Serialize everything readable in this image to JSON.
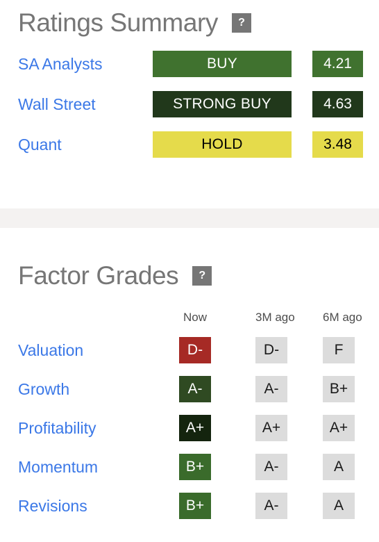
{
  "ratings_summary": {
    "title": "Ratings Summary",
    "help_icon": "question-mark-icon",
    "help_label": "?",
    "rows": [
      {
        "label": "SA Analysts",
        "rating": "BUY",
        "score": "4.21",
        "bar_bg": "#40722f",
        "bar_fg": "#ffffff",
        "score_bg": "#40722f",
        "score_fg": "#ffffff"
      },
      {
        "label": "Wall Street",
        "rating": "STRONG BUY",
        "score": "4.63",
        "bar_bg": "#21381b",
        "bar_fg": "#ffffff",
        "score_bg": "#21381b",
        "score_fg": "#ffffff"
      },
      {
        "label": "Quant",
        "rating": "HOLD",
        "score": "3.48",
        "bar_bg": "#e5db4b",
        "bar_fg": "#000000",
        "score_bg": "#e5db4b",
        "score_fg": "#000000"
      }
    ]
  },
  "factor_grades": {
    "title": "Factor Grades",
    "help_icon": "question-mark-icon",
    "help_label": "?",
    "columns": [
      "Now",
      "3M ago",
      "6M ago"
    ],
    "rows": [
      {
        "label": "Valuation",
        "now": "D-",
        "now_bg": "#a62a25",
        "now_fg": "#ffffff",
        "m3": "D-",
        "m3_bg": "#dcdcdc",
        "m3_fg": "#1a1a1a",
        "m6": "F",
        "m6_bg": "#dcdcdc",
        "m6_fg": "#1a1a1a"
      },
      {
        "label": "Growth",
        "now": "A-",
        "now_bg": "#2f4a22",
        "now_fg": "#ffffff",
        "m3": "A-",
        "m3_bg": "#dcdcdc",
        "m3_fg": "#1a1a1a",
        "m6": "B+",
        "m6_bg": "#dcdcdc",
        "m6_fg": "#1a1a1a"
      },
      {
        "label": "Profitability",
        "now": "A+",
        "now_bg": "#14240e",
        "now_fg": "#ffffff",
        "m3": "A+",
        "m3_bg": "#dcdcdc",
        "m3_fg": "#1a1a1a",
        "m6": "A+",
        "m6_bg": "#dcdcdc",
        "m6_fg": "#1a1a1a"
      },
      {
        "label": "Momentum",
        "now": "B+",
        "now_bg": "#3a6b2b",
        "now_fg": "#ffffff",
        "m3": "A-",
        "m3_bg": "#dcdcdc",
        "m3_fg": "#1a1a1a",
        "m6": "A",
        "m6_bg": "#dcdcdc",
        "m6_fg": "#1a1a1a"
      },
      {
        "label": "Revisions",
        "now": "B+",
        "now_bg": "#3a6b2b",
        "now_fg": "#ffffff",
        "m3": "A-",
        "m3_bg": "#dcdcdc",
        "m3_fg": "#1a1a1a",
        "m6": "A",
        "m6_bg": "#dcdcdc",
        "m6_fg": "#1a1a1a"
      }
    ]
  },
  "theme": {
    "link_blue": "#3b78e7",
    "title_gray": "#767676",
    "divider_gray": "#f4f2f1",
    "neutral_badge": "#dcdcdc"
  }
}
